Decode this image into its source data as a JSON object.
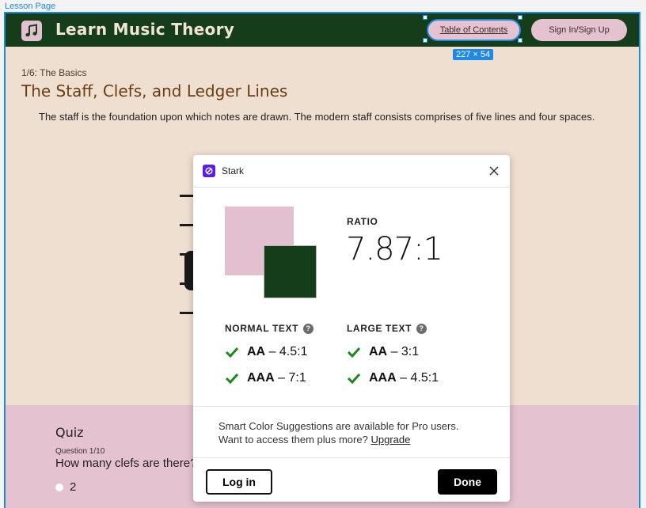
{
  "frame_label": "Lesson Page",
  "header": {
    "site_title": "Learn Music Theory",
    "toc_label": "Table of Contents",
    "sign_label": "Sign In/Sign Up",
    "selection_size": "227 × 54"
  },
  "lesson": {
    "breadcrumb": "1/6: The Basics",
    "title": "The Staff, Clefs, and Ledger Lines",
    "intro": "The staff is the foundation upon which notes are drawn. The modern staff consists comprises of five lines and four spaces."
  },
  "quiz": {
    "title": "Quiz",
    "question_number": "Question 1/10",
    "question_text": "How many clefs are there?",
    "option": "2"
  },
  "dialog": {
    "app_name": "Stark",
    "ratio_label": "RATIO",
    "ratio_value": "7.87:1",
    "normal_text": {
      "heading": "NORMAL TEXT",
      "aa": {
        "level": "AA",
        "threshold": "– 4.5:1"
      },
      "aaa": {
        "level": "AAA",
        "threshold": "– 7:1"
      }
    },
    "large_text": {
      "heading": "LARGE TEXT",
      "aa": {
        "level": "AA",
        "threshold": "– 3:1"
      },
      "aaa": {
        "level": "AAA",
        "threshold": "– 4.5:1"
      }
    },
    "pro_line1": "Smart Color Suggestions are available for Pro users.",
    "pro_line2": "Want to access them plus more?",
    "upgrade_label": "Upgrade",
    "login_label": "Log in",
    "done_label": "Done"
  },
  "colors": {
    "header_bg": "#163d1a",
    "pink": "#e3c0cf",
    "page_bg": "#efdfd0",
    "check_green": "#1a8a1a",
    "selection_blue": "#1e88e5"
  },
  "icons": [
    "music-note-icon",
    "stark-logo-icon",
    "close-icon",
    "help-icon",
    "check-icon"
  ]
}
